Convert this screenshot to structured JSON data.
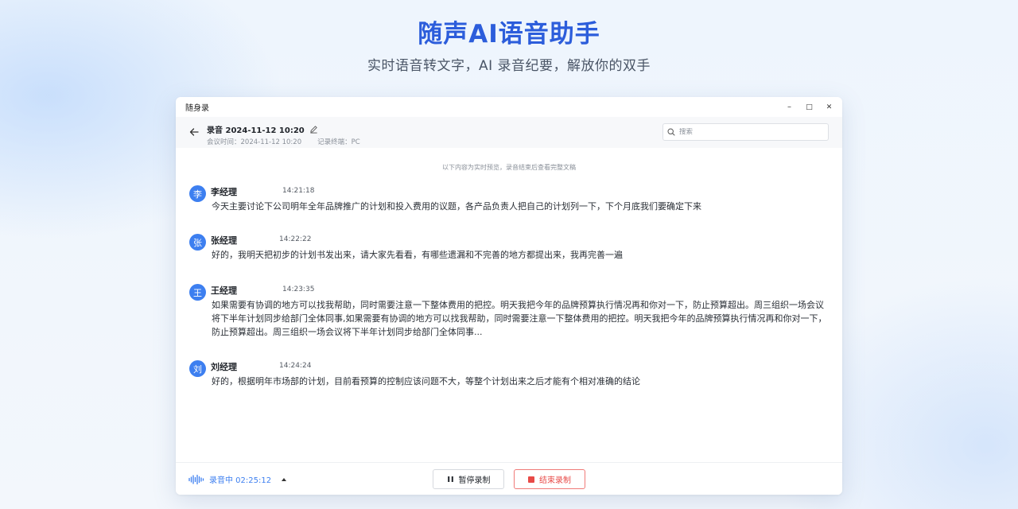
{
  "hero": {
    "title": "随声AI语音助手",
    "subtitle": "实时语音转文字，AI 录音纪要，解放你的双手"
  },
  "window": {
    "title": "随身录",
    "controls": {
      "minimize": "–",
      "maximize": "□",
      "close": "✕"
    }
  },
  "header": {
    "record_title": "录音 2024-11-12 10:20",
    "meeting_time": "会议时间：2024-11-12 10:20",
    "device": "记录终端：PC",
    "search_placeholder": "搜索"
  },
  "content": {
    "notice": "以下内容为实时预览，录音结束后查看完整文稿",
    "messages": [
      {
        "avatar": "李",
        "speaker": "李经理",
        "time": "14:21:18",
        "text": "今天主要讨论下公司明年全年品牌推广的计划和投入费用的议题，各产品负责人把自己的计划列一下，下个月底我们要确定下来"
      },
      {
        "avatar": "张",
        "speaker": "张经理",
        "time": "14:22:22",
        "text": "好的，我明天把初步的计划书发出来，请大家先看看，有哪些遗漏和不完善的地方都提出来，我再完善一遍"
      },
      {
        "avatar": "王",
        "speaker": "王经理",
        "time": "14:23:35",
        "text": "如果需要有协调的地方可以找我帮助，同时需要注意一下整体费用的把控。明天我把今年的品牌预算执行情况再和你对一下，防止预算超出。周三组织一场会议将下半年计划同步给部门全体同事,如果需要有协调的地方可以找我帮助，同时需要注意一下整体费用的把控。明天我把今年的品牌预算执行情况再和你对一下，防止预算超出。周三组织一场会议将下半年计划同步给部门全体同事..."
      },
      {
        "avatar": "刘",
        "speaker": "刘经理",
        "time": "14:24:24",
        "text": "好的，根据明年市场部的计划，目前看预算的控制应该问题不大，等整个计划出来之后才能有个相对准确的结论"
      }
    ]
  },
  "footer": {
    "status": "录音中 02:25:12",
    "pause_label": "暂停录制",
    "stop_label": "结束录制"
  },
  "colors": {
    "accent": "#3d7ff0",
    "hero_title": "#2c5ddb",
    "danger": "#e84a47"
  },
  "icons": [
    "back-arrow-icon",
    "edit-icon",
    "search-icon",
    "waveform-icon",
    "caret-up-icon",
    "pause-icon",
    "stop-icon"
  ]
}
